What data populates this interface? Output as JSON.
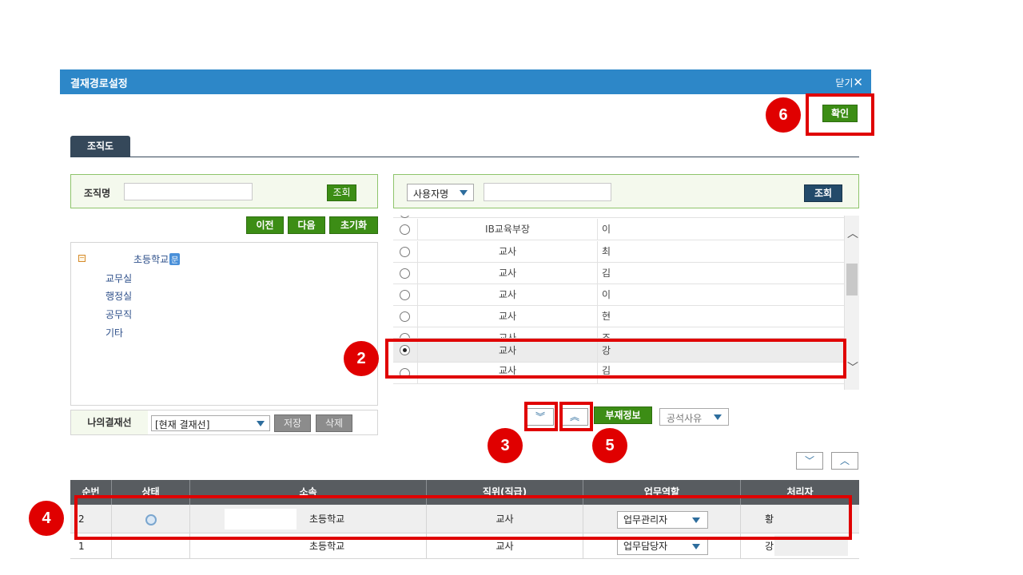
{
  "dialog": {
    "title": "결재경로설정",
    "close_label": "닫기"
  },
  "confirm_label": "확인",
  "tab_label": "조직도",
  "org_search": {
    "label": "조직명",
    "value": "",
    "button": "조회"
  },
  "tree_nav": {
    "prev": "이전",
    "next": "다음",
    "reset": "초기화"
  },
  "tree": {
    "root": "초등학교",
    "root_badge": "문",
    "children": [
      "교무실",
      "행정실",
      "공무직",
      "기타"
    ]
  },
  "my_line": {
    "label": "나의결재선",
    "selected": "[현재 결재선]",
    "save": "저장",
    "delete": "삭제"
  },
  "user_search": {
    "type": "사용자명",
    "value": "",
    "button": "조회"
  },
  "users": [
    {
      "position": "IB교육부장",
      "name": "이",
      "selected": false
    },
    {
      "position": "교사",
      "name": "최",
      "selected": false
    },
    {
      "position": "교사",
      "name": "김",
      "selected": false
    },
    {
      "position": "교사",
      "name": "이",
      "selected": false
    },
    {
      "position": "교사",
      "name": "현",
      "selected": false
    },
    {
      "position": "교사",
      "name": "조",
      "selected": false
    },
    {
      "position": "교사",
      "name": "강",
      "selected": true
    },
    {
      "position": "교사",
      "name": "김",
      "selected": false
    }
  ],
  "mid_actions": {
    "absence_info": "부재정보",
    "public_reason": "공석사유"
  },
  "badges": [
    "2",
    "3",
    "4",
    "5",
    "6"
  ],
  "table": {
    "headers": [
      "순번",
      "상태",
      "소속",
      "직위(직급)",
      "업무역할",
      "처리자"
    ],
    "rows": [
      {
        "seq": "2",
        "dept": "초등학교",
        "position": "교사",
        "role": "업무관리자",
        "handler": "황"
      },
      {
        "seq": "1",
        "dept": "초등학교",
        "position": "교사",
        "role": "업무담당자",
        "handler": "강"
      }
    ]
  },
  "colors": {
    "accent": "#2d87c8",
    "green": "#3c8d15",
    "navy": "#234a6a",
    "highlight": "#e00000"
  }
}
